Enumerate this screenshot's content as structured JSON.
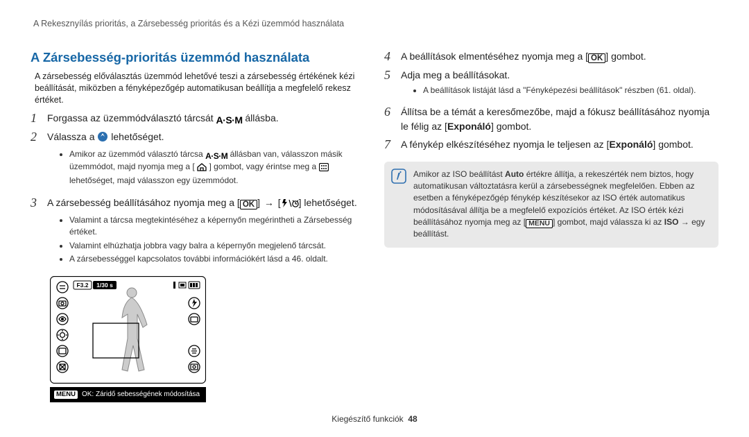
{
  "header": "A Rekesznyílás prioritás, a Zársebesség prioritás és a Kézi üzemmód használata",
  "section_title": "A Zársebesség-prioritás üzemmód használata",
  "intro": "A zársebesség előválasztás üzemmód lehetővé teszi a zársebesség értékének kézi beállítását, miközben a fényképezőgép automatikusan beállítja a megfelelő rekesz értéket.",
  "steps": {
    "1": {
      "pre": "Forgassa az üzemmódválasztó tárcsát ",
      "post": " állásba.",
      "icon": "A·S·M"
    },
    "2": {
      "pre": "Válassza a ",
      "post": " lehetőséget.",
      "notes": [
        {
          "pre": "Amikor az üzemmód választó tárcsa ",
          "mid": " állásban van, válasszon másik üzemmódot, majd nyomja meg a [",
          "post": "] gombot, vagy érintse meg a ",
          "tail": " lehetőséget, majd válasszon egy üzemmódot.",
          "icon_asm": "A·S·M"
        }
      ]
    },
    "3": {
      "pre": "A zársebesség beállításához nyomja meg a [",
      "arrow": "→",
      "post2": "] lehetőséget.",
      "ok": "OK",
      "notes": [
        "Valamint a tárcsa megtekintéséhez a képernyőn megérintheti a Zársebesség értéket.",
        "Valamint elhúzhatja jobbra vagy balra a képernyőn megjelenő tárcsát.",
        "A zársebességgel kapcsolatos további információkért lásd a 46. oldalt."
      ]
    },
    "4": {
      "pre": "A beállítások elmentéséhez nyomja meg a [",
      "post": "] gombot.",
      "ok": "OK"
    },
    "5": {
      "text": "Adja meg a beállításokat.",
      "notes": [
        "A beállítások listáját lásd a \"Fényképezési beállítások\" részben (61. oldal)."
      ]
    },
    "6": {
      "pre": "Állítsa be a témát a keresőmezőbe, majd a fókusz beállításához nyomja le félig az [",
      "bold": "Exponáló",
      "post": "] gombot."
    },
    "7": {
      "pre": "A fénykép elkészítéséhez nyomja le teljesen az [",
      "bold": "Exponáló",
      "post": "] gombot."
    }
  },
  "note": {
    "pre": "Amikor az ISO beállítást ",
    "auto": "Auto",
    "mid": " értékre állítja, a rekeszérték nem biztos, hogy automatikusan változtatásra kerül a zársebességnek megfelelően. Ebben az esetben a fényképezőgép fénykép készítésekor az ISO érték automatikus módosításával állítja be a megfelelő expozíciós értéket. Az ISO érték kézi beállításához nyomja meg az [",
    "menu": "MENU",
    "mid2": "] gombot, majd válassza ki az ",
    "iso": "ISO",
    "tail": " → egy beállítást."
  },
  "preview": {
    "top_f": "F3.2",
    "top_sh": "1/30 s",
    "menu": "MENU",
    "caption": "OK: Záridő sebességének módosítása"
  },
  "footer": {
    "label": "Kiegészítő funkciók",
    "page": "48"
  }
}
